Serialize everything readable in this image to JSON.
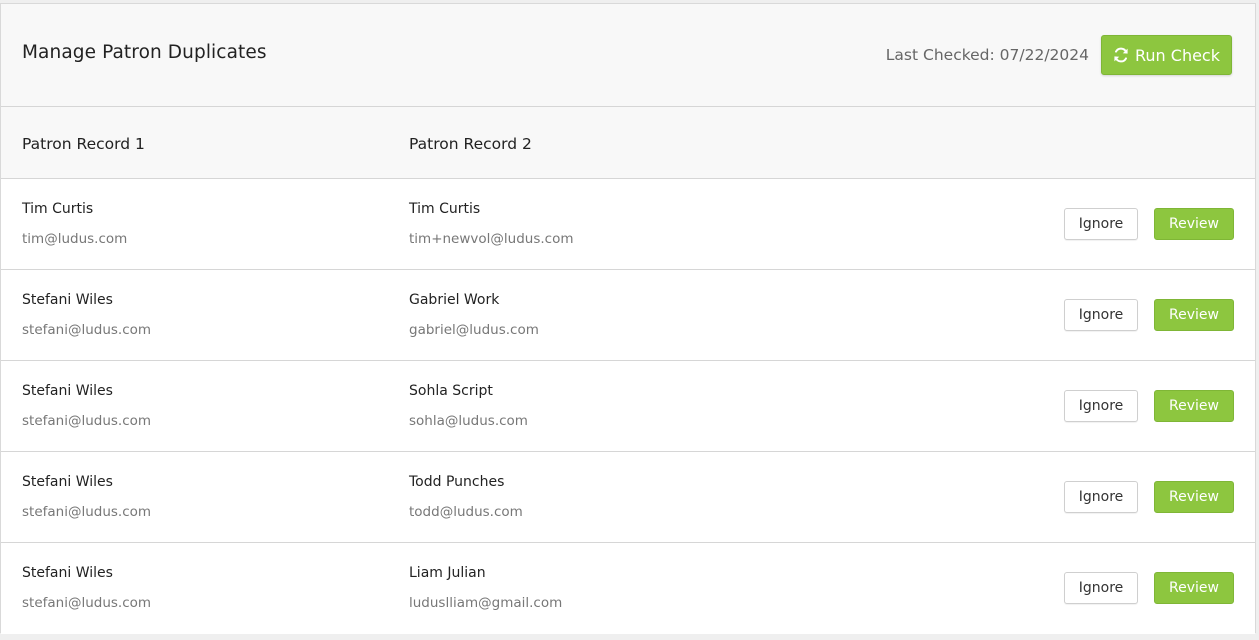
{
  "header": {
    "title": "Manage Patron Duplicates",
    "last_checked_label": "Last Checked: 07/22/2024",
    "run_check_label": "Run Check",
    "run_check_icon": "refresh-icon",
    "accent_color": "#8dc63f"
  },
  "columns": {
    "record1": "Patron Record 1",
    "record2": "Patron Record 2"
  },
  "actions": {
    "ignore_label": "Ignore",
    "review_label": "Review"
  },
  "rows": [
    {
      "record1": {
        "name": "Tim Curtis",
        "email": "tim@ludus.com"
      },
      "record2": {
        "name": "Tim Curtis",
        "email": "tim+newvol@ludus.com"
      }
    },
    {
      "record1": {
        "name": "Stefani Wiles",
        "email": "stefani@ludus.com"
      },
      "record2": {
        "name": "Gabriel Work",
        "email": "gabriel@ludus.com"
      }
    },
    {
      "record1": {
        "name": "Stefani Wiles",
        "email": "stefani@ludus.com"
      },
      "record2": {
        "name": "Sohla Script",
        "email": "sohla@ludus.com"
      }
    },
    {
      "record1": {
        "name": "Stefani Wiles",
        "email": "stefani@ludus.com"
      },
      "record2": {
        "name": "Todd Punches",
        "email": "todd@ludus.com"
      }
    },
    {
      "record1": {
        "name": "Stefani Wiles",
        "email": "stefani@ludus.com"
      },
      "record2": {
        "name": "Liam Julian",
        "email": "luduslliam@gmail.com"
      }
    }
  ]
}
